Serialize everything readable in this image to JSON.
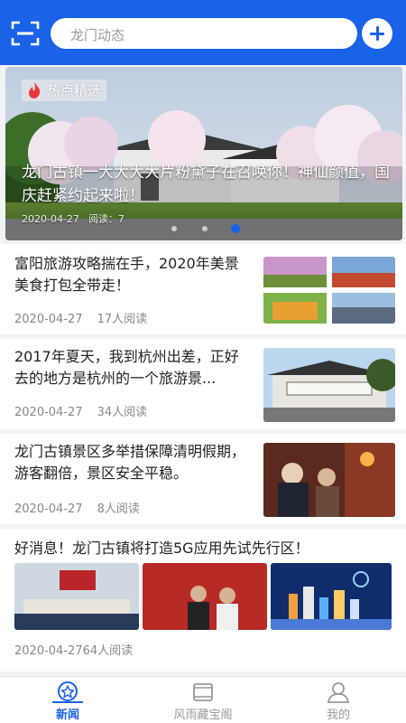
{
  "header": {
    "search_placeholder": "龙门动态",
    "accent_color": "#1a62e8"
  },
  "banner": {
    "tag": "热点精选",
    "title": "龙门古镇一大大大大片粉黛子在召唤你！神仙颜值，国庆赶紧约起来啦！",
    "date": "2020-04-27",
    "reads": "阅读：7",
    "dots": 3,
    "active_dot": 2
  },
  "news": [
    {
      "title": "富阳旅游攻略揣在手，2020年美景美食打包全带走！",
      "date": "2020-04-27",
      "reads": "17人阅读"
    },
    {
      "title": "2017年夏天，我到杭州出差，正好去的地方是杭州的一个旅游景...",
      "date": "2020-04-27",
      "reads": "34人阅读"
    },
    {
      "title": "龙门古镇景区多举措保障清明假期，游客翻倍，景区安全平稳。",
      "date": "2020-04-27",
      "reads": "8人阅读"
    },
    {
      "title": "好消息！龙门古镇将打造5G应用先试先行区！",
      "date": "2020-04-27",
      "reads": "64人阅读"
    }
  ],
  "tabs": [
    {
      "label": "新闻",
      "icon": "star-badge-icon"
    },
    {
      "label": "风雨藏宝阁",
      "icon": "scroll-icon"
    },
    {
      "label": "我的",
      "icon": "user-icon"
    }
  ]
}
